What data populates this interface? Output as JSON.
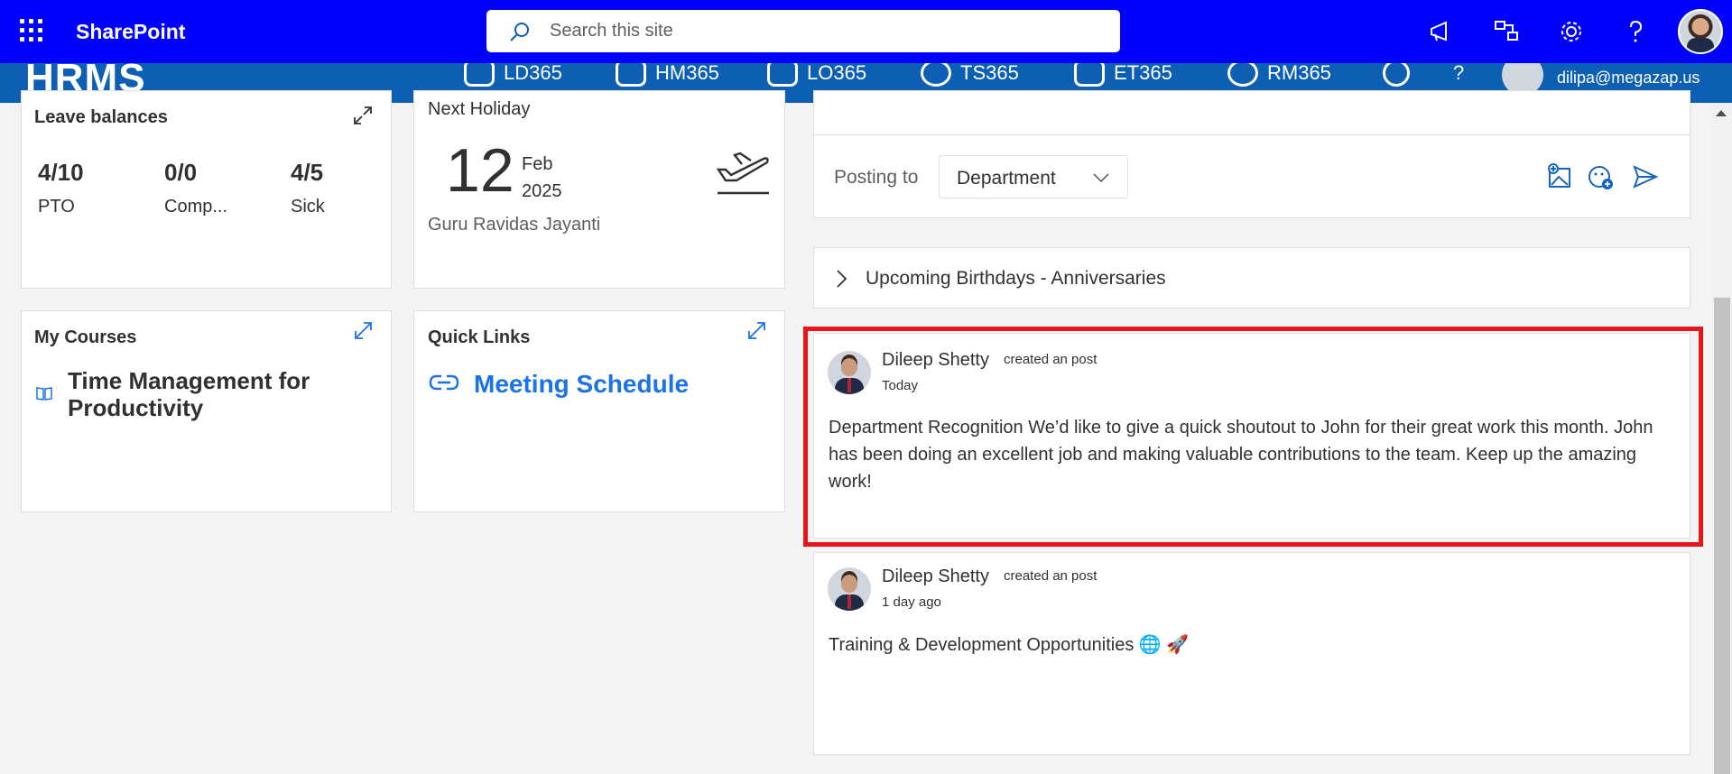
{
  "topbar": {
    "app_name": "SharePoint",
    "search_placeholder": "Search this site"
  },
  "hrms": {
    "logo": "HRMS",
    "nav": [
      "LD365",
      "HM365",
      "LO365",
      "TS365",
      "ET365",
      "RM365"
    ],
    "help": "?",
    "user_email": "dilipa@megazap.us"
  },
  "leave": {
    "title": "Leave balances",
    "stats": [
      {
        "value": "4/10",
        "label": "PTO"
      },
      {
        "value": "0/0",
        "label": "Comp..."
      },
      {
        "value": "4/5",
        "label": "Sick"
      }
    ]
  },
  "holiday": {
    "title": "Next Holiday",
    "day": "12",
    "month": "Feb",
    "year": "2025",
    "name": "Guru Ravidas Jayanti"
  },
  "courses": {
    "title": "My Courses",
    "course": "Time Management for Productivity"
  },
  "quick_links": {
    "title": "Quick Links",
    "link": "Meeting Schedule"
  },
  "composer": {
    "posting_to_label": "Posting to",
    "audience": "Department"
  },
  "birthdays": {
    "label": "Upcoming Birthdays - Anniversaries"
  },
  "posts": [
    {
      "author": "Dileep Shetty",
      "action": "created an post",
      "time": "Today",
      "body": "Department Recognition We’d like to give a quick shoutout to John for their great work this month. John has been doing an excellent job and making valuable contributions to the team. Keep up the amazing work!"
    },
    {
      "author": "Dileep Shetty",
      "action": "created an post",
      "time": "1 day ago",
      "body": "Training & Development Opportunities 🌐 🚀"
    }
  ],
  "colors": {
    "topbar": "#0000ff",
    "hrms_bar": "#0d5fb4",
    "link": "#1a73e8",
    "highlight": "#e8141c"
  }
}
